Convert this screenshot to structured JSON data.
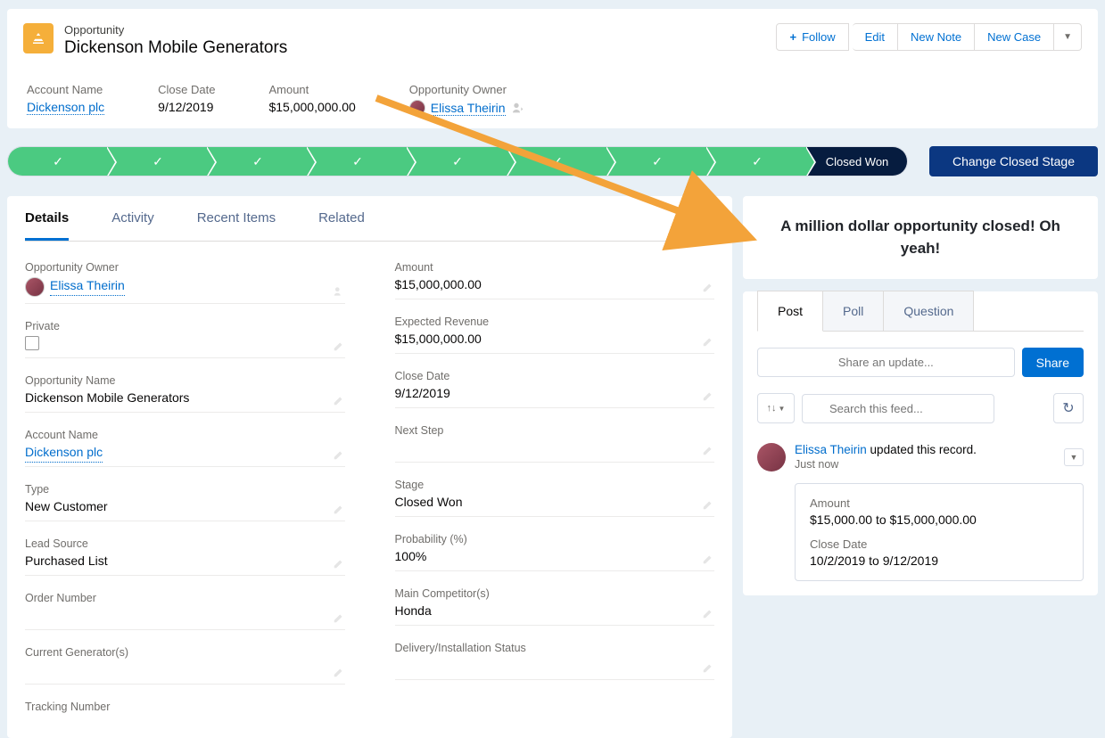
{
  "header": {
    "object_type": "Opportunity",
    "name": "Dickenson Mobile Generators",
    "actions": {
      "follow": "Follow",
      "edit": "Edit",
      "new_note": "New Note",
      "new_case": "New Case"
    },
    "summary": {
      "account_name_label": "Account Name",
      "account_name_value": "Dickenson plc",
      "close_date_label": "Close Date",
      "close_date_value": "9/12/2019",
      "amount_label": "Amount",
      "amount_value": "$15,000,000.00",
      "owner_label": "Opportunity Owner",
      "owner_value": "Elissa Theirin"
    }
  },
  "path": {
    "final_stage": "Closed Won",
    "button": "Change Closed Stage"
  },
  "tabs": {
    "details": "Details",
    "activity": "Activity",
    "recent": "Recent Items",
    "related": "Related"
  },
  "details": {
    "left": {
      "owner_label": "Opportunity Owner",
      "owner_value": "Elissa Theirin",
      "private_label": "Private",
      "opp_name_label": "Opportunity Name",
      "opp_name_value": "Dickenson Mobile Generators",
      "account_label": "Account Name",
      "account_value": "Dickenson plc",
      "type_label": "Type",
      "type_value": "New Customer",
      "lead_source_label": "Lead Source",
      "lead_source_value": "Purchased List",
      "order_number_label": "Order Number",
      "current_gen_label": "Current Generator(s)",
      "tracking_label": "Tracking Number"
    },
    "right": {
      "amount_label": "Amount",
      "amount_value": "$15,000,000.00",
      "expected_label": "Expected Revenue",
      "expected_value": "$15,000,000.00",
      "close_date_label": "Close Date",
      "close_date_value": "9/12/2019",
      "next_step_label": "Next Step",
      "stage_label": "Stage",
      "stage_value": "Closed Won",
      "probability_label": "Probability (%)",
      "probability_value": "100%",
      "competitor_label": "Main Competitor(s)",
      "competitor_value": "Honda",
      "delivery_label": "Delivery/Installation Status"
    }
  },
  "celebrate": "A million dollar opportunity closed! Oh yeah!",
  "feed": {
    "tabs": {
      "post": "Post",
      "poll": "Poll",
      "question": "Question"
    },
    "share_placeholder": "Share an update...",
    "share_button": "Share",
    "search_placeholder": "Search this feed...",
    "item": {
      "user": "Elissa Theirin",
      "action": " updated this record.",
      "time": "Just now",
      "amount_label": "Amount",
      "amount_value": "$15,000.00 to $15,000,000.00",
      "close_label": "Close Date",
      "close_value": "10/2/2019 to 9/12/2019"
    }
  }
}
